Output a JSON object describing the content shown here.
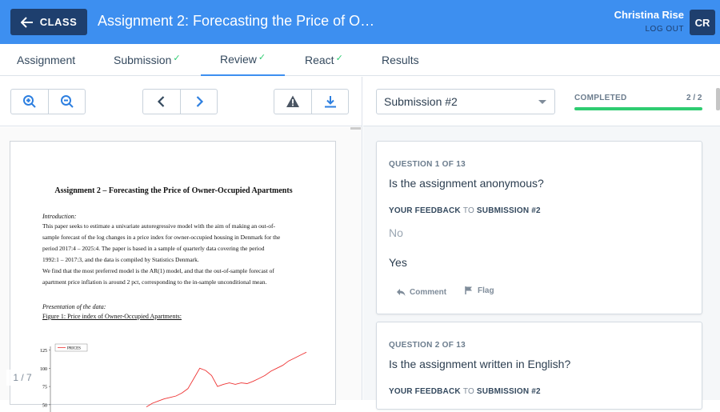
{
  "header": {
    "back_label": "CLASS",
    "title": "Assignment 2: Forecasting the Price of O…",
    "user_name": "Christina Rise",
    "logout_label": "LOG OUT",
    "avatar_initials": "CR"
  },
  "tabs": [
    {
      "label": "Assignment",
      "check": ""
    },
    {
      "label": "Submission",
      "check": "✓"
    },
    {
      "label": "Review",
      "check": "✓"
    },
    {
      "label": "React",
      "check": "✓"
    },
    {
      "label": "Results",
      "check": ""
    }
  ],
  "colors": {
    "accent": "#3d8ff0",
    "dark": "#1e3f6e",
    "success": "#2ecc71"
  },
  "toolbar": {
    "icons": [
      "zoom-in-icon",
      "zoom-out-icon",
      "chevron-left-icon",
      "chevron-right-icon",
      "warning-icon",
      "download-icon"
    ]
  },
  "document": {
    "title": "Assignment 2 – Forecasting the Price of Owner-Occupied Apartments",
    "intro_heading": "Introduction:",
    "intro_lines": [
      "This paper seeks to estimate a univariate autoregressive model with the aim of making an out-of-",
      "sample forecast of the log changes in a price index for owner-occupied housing in Denmark for the",
      "period 2017:4 – 2025:4. The paper is based in a sample of quarterly data covering the period",
      "1992:1 – 2017:3, and the data is compiled by Statistics Denmark.",
      "We find that the most preferred model is the AR(1) model, and that the out-of-sample forecast of",
      "apartment price inflation is around 2 pct, corresponding to the in-sample unconditional mean."
    ],
    "presentation_heading": "Presentation of the data:",
    "figure_caption": "Figure 1: Price index of Owner-Occupied Apartments:",
    "page_indicator": "1 / 7"
  },
  "chart_data": {
    "type": "line",
    "series": [
      {
        "name": "PRICES",
        "values": [
          47,
          52,
          55,
          58,
          60,
          62,
          66,
          72,
          86,
          100,
          97,
          90,
          75,
          78,
          80,
          78,
          80,
          79,
          82,
          86,
          90,
          96,
          100,
          104,
          110,
          114,
          118,
          122
        ]
      }
    ],
    "yticks": [
      "125",
      "100",
      "75",
      "50"
    ],
    "ylim": [
      40,
      130
    ]
  },
  "review": {
    "submission_select": "Submission #2",
    "status_label": "COMPLETED",
    "status_count": "2 / 2",
    "progress_fraction": 1.0
  },
  "questions": [
    {
      "label": "QUESTION 1 OF 13",
      "text": "Is the assignment anonymous?",
      "feedback_prefix": "YOUR FEEDBACK",
      "feedback_to": "TO",
      "feedback_target": "SUBMISSION #2",
      "options": [
        "No",
        "Yes"
      ],
      "comment_label": "Comment",
      "flag_label": "Flag"
    },
    {
      "label": "QUESTION 2 OF 13",
      "text": "Is the assignment written in English?",
      "feedback_prefix": "YOUR FEEDBACK",
      "feedback_to": "TO",
      "feedback_target": "SUBMISSION #2"
    }
  ]
}
